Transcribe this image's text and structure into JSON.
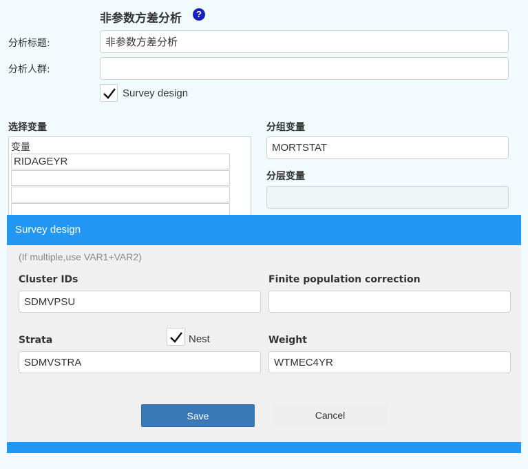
{
  "form": {
    "title": "非参数方差分析",
    "analysis_title_label": "分析标题:",
    "analysis_title_value": "非参数方差分析",
    "population_label": "分析人群:",
    "population_value": "",
    "survey_design_label": "Survey design",
    "survey_design_checked": true
  },
  "variables": {
    "select_label": "选择变量",
    "list_header": "变量",
    "items": [
      "RIDAGEYR",
      "",
      "",
      ""
    ],
    "group_label": "分组变量",
    "group_value": "MORTSTAT",
    "strata_label": "分层变量",
    "strata_value": ""
  },
  "modal": {
    "header": "Survey design",
    "hint": "(If multiple,use VAR1+VAR2)",
    "cluster_label": "Cluster IDs",
    "cluster_value": "SDMVPSU",
    "fpc_label": "Finite population correction",
    "fpc_value": "",
    "strata_label": "Strata",
    "strata_value": "SDMVSTRA",
    "nest_label": "Nest",
    "nest_checked": true,
    "weight_label": "Weight",
    "weight_value": "WTMEC4YR",
    "save_label": "Save",
    "cancel_label": "Cancel"
  },
  "colors": {
    "accent": "#2196f3",
    "save_button": "#3a79b8",
    "help_icon": "#1a1fbf",
    "page_background": "#f1fbfd"
  }
}
